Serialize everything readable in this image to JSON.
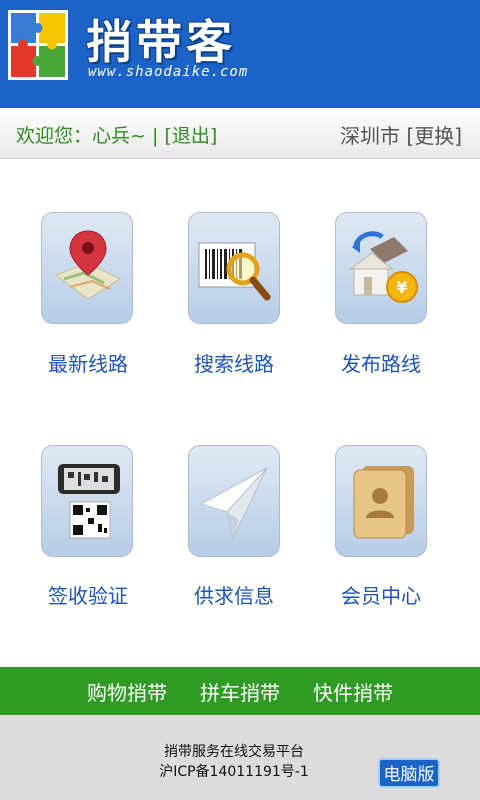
{
  "header": {
    "brand_name": "捎带客",
    "brand_url": "www.shaodaike.com",
    "logo_icon": "puzzle-logo-icon"
  },
  "userbar": {
    "welcome_prefix": "欢迎您：心兵~",
    "separator": "|",
    "logout": "[退出]",
    "city": "深圳市",
    "change_city": "[更换]"
  },
  "menu": [
    {
      "label": "最新线路",
      "icon": "map-pin-icon"
    },
    {
      "label": "搜索线路",
      "icon": "barcode-search-icon"
    },
    {
      "label": "发布路线",
      "icon": "house-coin-icon"
    },
    {
      "label": "签收验证",
      "icon": "qr-phone-icon"
    },
    {
      "label": "供求信息",
      "icon": "paper-plane-icon"
    },
    {
      "label": "会员中心",
      "icon": "contact-book-icon"
    }
  ],
  "bottom_nav": [
    "购物捎带",
    "拼车捎带",
    "快件捎带"
  ],
  "footer": {
    "line1": "捎带服务在线交易平台",
    "line2": "沪ICP备14011191号-1",
    "pc_button": "电脑版"
  },
  "colors": {
    "header_blue": "#1b63c6",
    "nav_green": "#2f9b25",
    "label_blue": "#1e55b8",
    "welcome_green": "#2f8e1e"
  }
}
